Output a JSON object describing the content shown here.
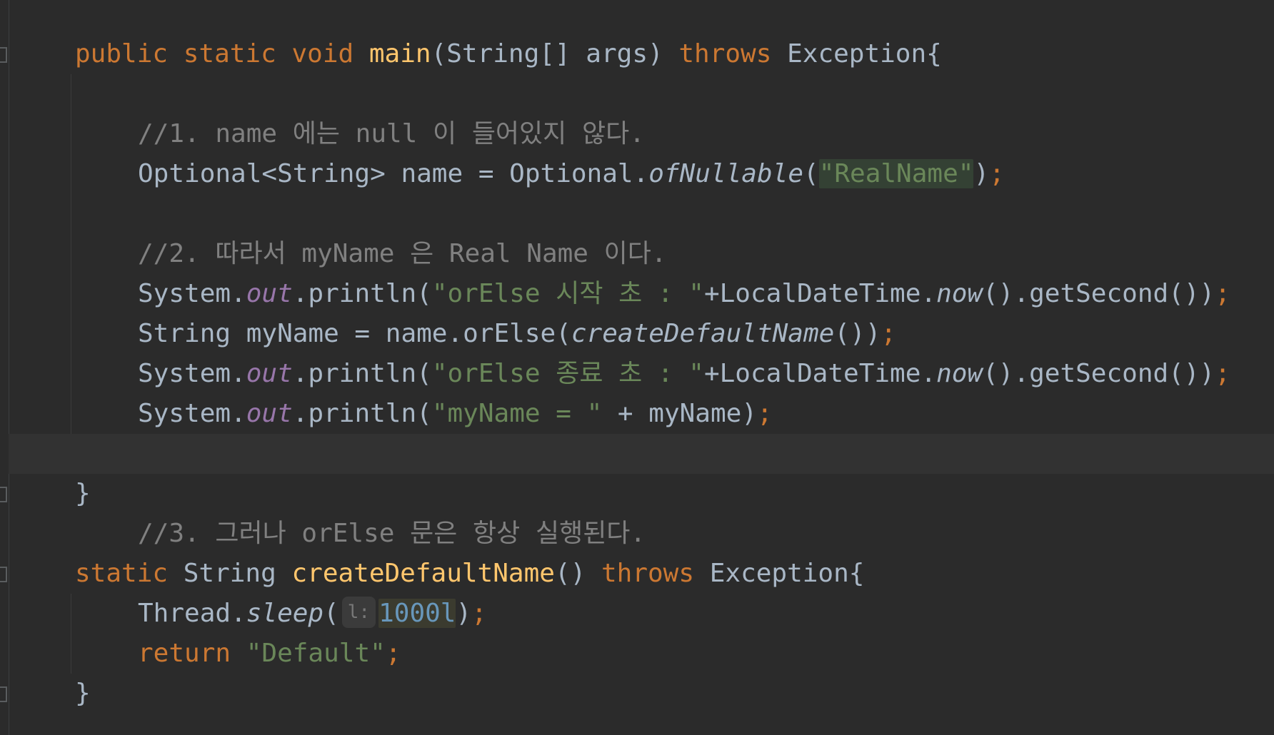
{
  "code": {
    "line1": {
      "kw1": "public",
      "kw2": "static",
      "kw3": "void",
      "method": "main",
      "params": "(String[] args)",
      "kw_throws": "throws",
      "exception": "Exception{"
    },
    "comment1": "//1. name 에는 null 이 들어있지 않다.",
    "line3": {
      "decl": "Optional<String> name = Optional.",
      "call": "ofNullable",
      "open": "(",
      "arg": "\"RealName\"",
      "close": ")",
      "semi": ";"
    },
    "comment2": "//2. 따라서 myName 은 Real Name 이다.",
    "line5": {
      "sys": "System.",
      "out": "out",
      "println": ".println(",
      "str": "\"orElse 시작 초 : \"",
      "plus": "+LocalDateTime.",
      "now": "now",
      "rest": "().getSecond())",
      "semi": ";"
    },
    "line6": {
      "decl": "String myName = name.orElse(",
      "call": "createDefaultName",
      "close": "())",
      "semi": ";"
    },
    "line7": {
      "sys": "System.",
      "out": "out",
      "println": ".println(",
      "str": "\"orElse 종료 초 : \"",
      "plus": "+LocalDateTime.",
      "now": "now",
      "rest": "().getSecond())",
      "semi": ";"
    },
    "line8": {
      "sys": "System.",
      "out": "out",
      "println": ".println(",
      "str": "\"myName = \"",
      "rest": " + myName)",
      "semi": ";"
    },
    "close1": "}",
    "comment3": "//3. 그러나 orElse 문은 항상 실행된다.",
    "line11": {
      "kw": "static",
      "type": "String",
      "method": "createDefaultName",
      "parens": "()",
      "kw_throws": "throws",
      "exception": "Exception{"
    },
    "line12": {
      "cls": "Thread.",
      "call": "sleep",
      "open": "(",
      "hint": "l:",
      "num": "1000l",
      "close": ")",
      "semi": ";"
    },
    "line13": {
      "kw": "return",
      "str": "\"Default\"",
      "semi": ";"
    },
    "close2": "}"
  },
  "colors": {
    "background": "#2b2b2b",
    "keyword": "#cc7832",
    "method": "#ffc66d",
    "string": "#6a8759",
    "comment": "#808080",
    "number": "#6897bb",
    "field": "#9876aa",
    "default": "#a9b7c6"
  }
}
